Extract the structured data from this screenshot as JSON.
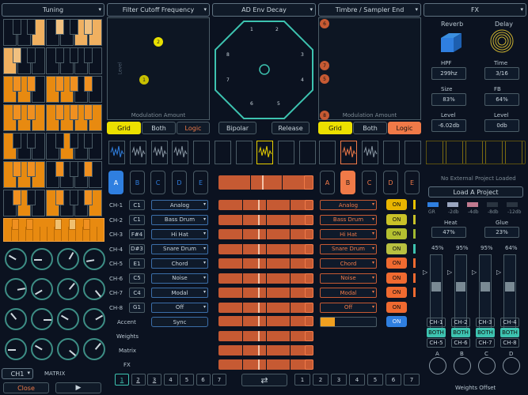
{
  "header": {
    "tuning": "Tuning",
    "filter": "Filter Cutoff Frequency",
    "env": "AD Env Decay",
    "timbre": "Timbre / Sampler End",
    "fx": "FX"
  },
  "xy_left": {
    "axis_x": "Modulation Amount",
    "axis_y": "Level",
    "pt1": "1",
    "pt2": "2"
  },
  "xy_right": {
    "axis_x": "Modulation Amount",
    "pt8a": "6",
    "pt7": "7",
    "pt5": "5",
    "pt8": "8"
  },
  "mode_left": {
    "grid": "Grid",
    "both": "Both",
    "logic": "Logic"
  },
  "mode_right": {
    "grid": "Grid",
    "both": "Both",
    "logic": "Logic"
  },
  "env": {
    "bipolar": "Bipolar",
    "release": "Release",
    "nums": [
      "1",
      "2",
      "3",
      "4",
      "5",
      "6",
      "7",
      "8"
    ]
  },
  "tabs_left": [
    "A",
    "B",
    "C",
    "D",
    "E"
  ],
  "tabs_right": [
    "A",
    "B",
    "C",
    "D",
    "E"
  ],
  "channels": [
    {
      "ch": "CH-1",
      "key": "C1",
      "inst": "Analog",
      "rinst": "Analog",
      "on": "ON",
      "on_color": "#e8b400"
    },
    {
      "ch": "CH-2",
      "key": "C1",
      "inst": "Bass Drum",
      "rinst": "Bass Drum",
      "on": "ON",
      "on_color": "#c9c228"
    },
    {
      "ch": "CH-3",
      "key": "F#4",
      "inst": "Hi Hat",
      "rinst": "Hi Hat",
      "on": "ON",
      "on_color": "#b4c030"
    },
    {
      "ch": "CH-4",
      "key": "D#3",
      "inst": "Snare Drum",
      "rinst": "Snare Drum",
      "on": "ON",
      "on_color": "#b8c040"
    },
    {
      "ch": "CH-5",
      "key": "E1",
      "inst": "Chord",
      "rinst": "Chord",
      "on": "ON",
      "on_color": "#f06a30"
    },
    {
      "ch": "CH-6",
      "key": "C5",
      "inst": "Noise",
      "rinst": "Noise",
      "on": "ON",
      "on_color": "#f06a30"
    },
    {
      "ch": "CH-7",
      "key": "C4",
      "inst": "Modal",
      "rinst": "Modal",
      "on": "ON",
      "on_color": "#f06a30"
    },
    {
      "ch": "CH-8",
      "key": "G1",
      "inst": "Off",
      "rinst": "Off",
      "on": "ON",
      "on_color": "#f06a30"
    }
  ],
  "accent": {
    "label": "Accent",
    "value": "Sync",
    "on": "ON"
  },
  "row_labels": {
    "weights": "Weights",
    "matrix": "Matrix",
    "fx": "FX"
  },
  "pages": [
    "1",
    "2",
    "3",
    "4",
    "5",
    "6",
    "7"
  ],
  "pages_right": [
    "1",
    "2",
    "3",
    "4",
    "5",
    "6",
    "7"
  ],
  "swap_icon": "⇄",
  "bottom_left": {
    "ch": "CH1",
    "matrix": "MATRIX",
    "close": "Close"
  },
  "fx": {
    "reverb": "Reverb",
    "delay": "Delay",
    "hpf_l": "HPF",
    "hpf_v": "299hz",
    "time_l": "Time",
    "time_v": "3/16",
    "size_l": "Size",
    "size_v": "83%",
    "fb_l": "FB",
    "fb_v": "64%",
    "lvl_l": "Level",
    "lvl_v": "-6.02db",
    "lvl2_l": "Level",
    "lvl2_v": "0db",
    "no_project": "No External Project Loaded",
    "load": "Load A Project",
    "gr": "GR",
    "db2": "-2db",
    "db4": "-4db",
    "db8": "-8db",
    "db12": "-12db",
    "heat_l": "Heat",
    "heat_v": "47%",
    "glue_l": "Glue",
    "glue_v": "23%",
    "pcts": [
      "45%",
      "95%",
      "95%",
      "64%"
    ],
    "ch_top": [
      "CH-1",
      "CH-2",
      "CH-3",
      "CH-4"
    ],
    "both": [
      "BOTH",
      "BOTH",
      "BOTH",
      "BOTH"
    ],
    "ch_bot": [
      "CH-5",
      "CH-6",
      "CH-7",
      "CH-8"
    ],
    "knobs": [
      "A",
      "B",
      "C",
      "D"
    ],
    "weights_offset": "Weights Offset"
  },
  "colors": {
    "accent_orange": "#f07a48",
    "accent_yellow": "#f2e600",
    "teal": "#3dc3b0",
    "blue": "#2f7fe0"
  }
}
